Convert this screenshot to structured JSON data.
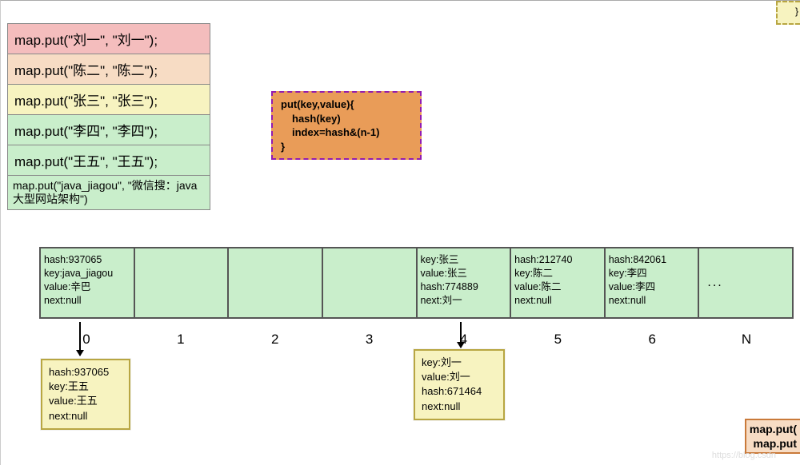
{
  "puts": [
    {
      "text": "map.put(\"刘一\", \"刘一\");",
      "class": "pink"
    },
    {
      "text": "map.put(\"陈二\", \"陈二\");",
      "class": "peach"
    },
    {
      "text": "map.put(\"张三\", \"张三\");",
      "class": "yellow"
    },
    {
      "text": "map.put(\"李四\", \"李四\");",
      "class": "mint"
    },
    {
      "text": "map.put(\"王五\", \"王五\");",
      "class": "mint"
    },
    {
      "text": "map.put(\"java_jiagou\", \"微信搜：java大型网站架构\")",
      "class": "mint small"
    }
  ],
  "algo": {
    "l1": "put(key,value){",
    "l2": "hash(key)",
    "l3": "index=hash&(n-1)",
    "l4": "}"
  },
  "buckets": [
    {
      "lines": [
        "hash:937065",
        "key:java_jiagou",
        "value:辛巴",
        "next:null"
      ]
    },
    {
      "lines": []
    },
    {
      "lines": []
    },
    {
      "lines": []
    },
    {
      "lines": [
        "key:张三",
        "value:张三",
        "hash:774889",
        "next:刘一"
      ]
    },
    {
      "lines": [
        "hash:212740",
        "key:陈二",
        "value:陈二",
        "next:null"
      ]
    },
    {
      "lines": [
        "hash:842061",
        "key:李四",
        "value:李四",
        "next:null"
      ]
    },
    {
      "dots": "..."
    }
  ],
  "indices": [
    "0",
    "1",
    "2",
    "3",
    "4",
    "5",
    "6",
    "N"
  ],
  "extra_nodes": {
    "zero": {
      "lines": [
        "hash:937065",
        "key:王五",
        "value:王五",
        "next:null"
      ]
    },
    "four": {
      "lines": [
        "key:刘一",
        "value:刘一",
        "hash:671464",
        "next:null"
      ]
    }
  },
  "corner": "}",
  "bottom_snip": {
    "l1": "map.put(",
    "l2": "map.put"
  },
  "watermark": "https://blog.csdn"
}
